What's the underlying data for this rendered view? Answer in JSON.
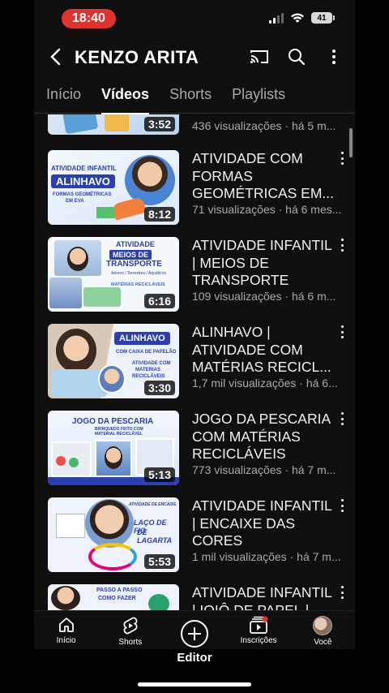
{
  "status": {
    "time": "18:40",
    "battery": "41"
  },
  "header": {
    "channel_name": "KENZO ARITA"
  },
  "tabs": [
    {
      "label": "Início",
      "active": false
    },
    {
      "label": "Vídeos",
      "active": true
    },
    {
      "label": "Shorts",
      "active": false
    },
    {
      "label": "Playlists",
      "active": false
    }
  ],
  "videos": [
    {
      "title": "",
      "meta": "436 visualizações · há 5 m...",
      "duration": "3:52",
      "thumb_lines": []
    },
    {
      "title": "ATIVIDADE COM FORMAS GEOMÉTRICAS EM...",
      "meta": "71 visualizações · há 6 mes...",
      "duration": "8:12",
      "thumb_lines": [
        "ATIVIDADE INFANTIL",
        "ALINHAVO",
        "FORMAS GEOMÉTRICAS",
        "EM EVA"
      ]
    },
    {
      "title": "ATIVIDADE INFANTIL | MEIOS DE TRANSPORTE",
      "meta": "109 visualizações · há 6 m...",
      "duration": "6:16",
      "thumb_lines": [
        "ATIVIDADE",
        "MEIOS DE",
        "TRANSPORTE",
        "Aéreos / Terrestres / Aquáticos",
        "MATÉRIAS RECICLÁVEIS"
      ]
    },
    {
      "title": "ALINHAVO | ATIVIDADE COM MATÉRIAS RECICL...",
      "meta": "1,7 mil visualizações · há 6...",
      "duration": "3:30",
      "thumb_lines": [
        "ALINHAVO",
        "COM CAIXA DE PAPELÃO",
        "ATIVIDADE COM",
        "MATERIAS",
        "RECICLÁVEIS"
      ]
    },
    {
      "title": "JOGO DA PESCARIA COM MATÉRIAS RECICLÁVEIS",
      "meta": "773 visualizações · há 7 m...",
      "duration": "5:13",
      "thumb_lines": [
        "JOGO DA PESCARIA",
        "BRINQUEDO FEITO COM",
        "MATERIAL RECICLÁVEL"
      ]
    },
    {
      "title": "ATIVIDADE INFANTIL | ENCAIXE DAS CORES",
      "meta": "1 mil visualizações · há 7 m...",
      "duration": "5:53",
      "thumb_lines": [
        "ATIVIDADE DE ENCAIXE",
        "LAÇO DE FIO",
        "DE LAGARTA"
      ]
    },
    {
      "title": "ATIVIDADE INFANTIL | IOIÔ DE PAPEL |",
      "meta": "",
      "duration": "",
      "thumb_lines": [
        "PASSO A PASSO",
        "COMO FAZER"
      ]
    }
  ],
  "bottom_nav": [
    {
      "label": "Início",
      "icon": "home-icon"
    },
    {
      "label": "Shorts",
      "icon": "shorts-icon"
    },
    {
      "label": "",
      "icon": "create-icon"
    },
    {
      "label": "Inscrições",
      "icon": "subscriptions-icon"
    },
    {
      "label": "Você",
      "icon": "avatar"
    }
  ],
  "editor_label": "Editor",
  "colors": {
    "accent": "#e0332e",
    "background": "#0f0f0f",
    "thumb_blue": "#2a3fb0"
  }
}
